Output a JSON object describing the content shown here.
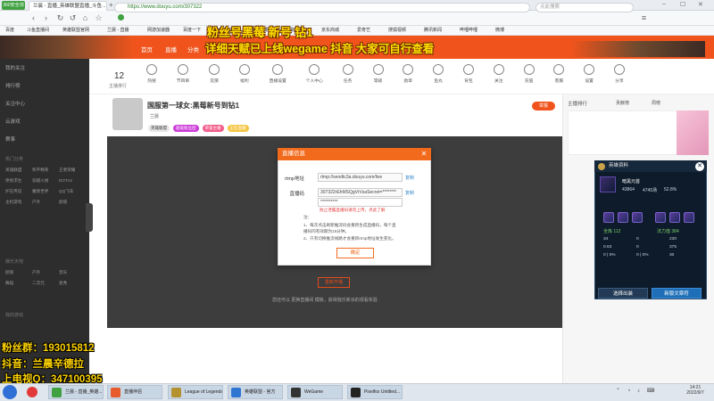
{
  "browser": {
    "logo": "360安全浏览器",
    "tabs": [
      {
        "label": "兰晨 - 直播_英雄联盟直播_斗鱼..."
      }
    ],
    "url": "https://www.douyu.com/307322",
    "search_placeholder": "点此搜索",
    "bookmarks": [
      "百度",
      "斗鱼直播间",
      "英雄联盟官网",
      "兰晨 - 直播",
      "网游加速器",
      "百度一下",
      "QQ空间",
      "新浪微博",
      "网易邮箱",
      "京东商城",
      "爱奇艺",
      "搜狐视频",
      "腾讯新闻",
      "哔哩哔哩",
      "微博"
    ]
  },
  "overlay": {
    "title_line1": "粉丝号黑莓 新号 钻1",
    "title_line2": "详细天赋已上线wegame 抖音 大家可自行查看",
    "fans_group": "粉丝群：193015812",
    "douyin": "抖音：兰晨辛德拉",
    "qq": "上电视Q：347100395"
  },
  "site": {
    "nav": [
      "首页",
      "直播",
      "分类",
      "视频",
      "游戏"
    ],
    "sidebar": {
      "items": [
        "我的关注",
        "排行榜",
        "关注中心",
        "云游戏",
        "赛事"
      ],
      "section1": "热门分类",
      "grid1": [
        "英雄联盟",
        "和平精英",
        "王者荣耀",
        "绝地求生",
        "穿越火线",
        "DOTA2",
        "炉石传说",
        "魔兽世界",
        "QQ飞车",
        "主机游戏",
        "户外",
        "颜值"
      ],
      "section2": "娱乐天地",
      "grid2": [
        "颜值",
        "户外",
        "音乐",
        "舞蹈",
        "二次元",
        "星秀"
      ],
      "section3": "我的游戏"
    },
    "toolbar": {
      "follow_count": "12",
      "follow_label": "主播排行",
      "items": [
        "热搜",
        "节目单",
        "竞猜",
        "福利",
        "直播设置",
        "个人中心",
        "任务",
        "等级",
        "勋章",
        "鱼丸",
        "背包",
        "关注",
        "充值",
        "客服",
        "设置",
        "分享",
        "更多",
        "推荐"
      ]
    },
    "room": {
      "title": "国服第一球女:黑莓新号到钻1",
      "streamer": "兰晨",
      "report_btn": "举报",
      "badges": [
        "英雄联盟",
        "超级粉丝团",
        "荣誉主播",
        "正在直播"
      ]
    },
    "right_panel": {
      "title": "主播排行",
      "tabs": [
        "贡献榜",
        "周榜"
      ]
    }
  },
  "modal": {
    "title": "直播信息",
    "rtmp_label": "rtmp地址",
    "rtmp_value": "rtmp://sendtc3a.douyu.com/live",
    "key_label": "直播码",
    "key_value": "307322rEhMSQgVrVsaSecret=********",
    "copy_label": "复制",
    "select_label": "**********",
    "warning": "防止泄露直播码请勿上传，点此了解",
    "note_head": "注：",
    "notes": [
      "1、每次点击刷新推流码会重新生成直播码，每个直",
      "播码的有效期为15分钟。",
      "2、只有切换推流线路才会重新rtmp地址发生变化。"
    ],
    "ok_label": "确定",
    "video_btn": "重新开播",
    "video_hint": "您还可以 更换直播间 模板，获得独乐新派的观看体验"
  },
  "hero_card": {
    "title": "英雄资料",
    "name": "暗黑元首",
    "stats": [
      "43864",
      "4745场",
      "52.8%"
    ],
    "labels": [
      "全炼 112",
      "法力值 384"
    ],
    "attr_rows": [
      [
        "34",
        "0",
        "230"
      ],
      [
        "0.63",
        "0",
        "375"
      ],
      [
        "0 | 0%",
        "0 | 0%",
        "30"
      ]
    ],
    "btn_left": "选择出装",
    "btn_right": "新版文章符"
  },
  "taskbar": {
    "tasks": [
      "兰晨 - 直播_英雄...",
      "直播伴侣",
      "League of Legends",
      "英雄联盟 - 官方",
      "WeGame",
      "Pixelfox Untitled..."
    ],
    "time": "14:21",
    "date": "2022/9/7",
    "colors": {
      "accent": "#f26b1d",
      "douyu_orange": "#f0541c",
      "sidebar": "#2d2d2d",
      "video": "#3d3d3d"
    }
  }
}
